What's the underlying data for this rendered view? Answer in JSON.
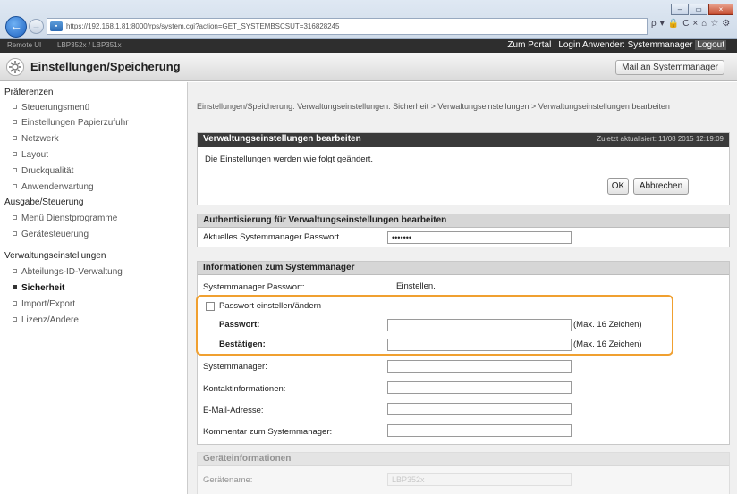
{
  "browser": {
    "url": "https://192.168.1.81:8000/rps/system.cgi?action=GET_SYSTEMBSCSUT=316828245",
    "tools": [
      "ρ",
      "▾",
      "🔒",
      "C",
      "×",
      "⌂",
      "☆",
      "⚙"
    ],
    "window_buttons": [
      "–",
      "▭",
      "×"
    ]
  },
  "topbar": {
    "device": "Remote UI",
    "model": "LBP352x / LBP351x",
    "links": [
      "Zum Portal",
      "Login Anwender: Systemmanager",
      "Logout"
    ]
  },
  "header": {
    "title": "Einstellungen/Speicherung",
    "mail_button": "Mail an Systemmanager"
  },
  "sidebar": {
    "categories": [
      {
        "label": "Präferenzen",
        "items": [
          "Steuerungsmenü",
          "Einstellungen Papierzufuhr",
          "Netzwerk",
          "Layout",
          "Druckqualität",
          "Anwenderwartung"
        ]
      },
      {
        "label": "Ausgabe/Steuerung",
        "items": [
          "Menü Dienstprogramme",
          "Gerätesteuerung"
        ]
      },
      {
        "label": "Verwaltungseinstellungen",
        "items": [
          "Abteilungs-ID-Verwaltung",
          "Sicherheit",
          "Import/Export",
          "Lizenz/Andere"
        ]
      }
    ],
    "active_item": "Sicherheit"
  },
  "main": {
    "breadcrumb": "Einstellungen/Speicherung: Verwaltungseinstellungen: Sicherheit > Verwaltungseinstellungen > Verwaltungseinstellungen bearbeiten",
    "edit_panel": {
      "title": "Verwaltungseinstellungen bearbeiten",
      "last_updated": "Zuletzt aktualisiert: 11/08 2015 12:19:09",
      "message": "Die Einstellungen werden wie folgt geändert.",
      "ok": "OK",
      "cancel": "Abbrechen"
    },
    "auth_panel": {
      "title": "Authentisierung für Verwaltungseinstellungen bearbeiten",
      "current_pw_label": "Aktuelles Systemmanager Passwort",
      "current_pw_value": "•••••••"
    },
    "info_panel": {
      "title": "Informationen zum Systemmanager",
      "pw_label": "Systemmanager Passwort:",
      "pw_status": "Einstellen.",
      "change_pw_label": "Passwort einstellen/ändern",
      "password_label": "Passwort:",
      "confirm_label": "Bestätigen:",
      "max_hint": "(Max. 16 Zeichen)",
      "manager_label": "Systemmanager:",
      "contact_label": "Kontaktinformationen:",
      "email_label": "E-Mail-Adresse:",
      "comment_label": "Kommentar zum Systemmanager:"
    },
    "device_panel": {
      "title": "Geräteinformationen",
      "device_name_label": "Gerätename:",
      "device_name_value": "LBP352x"
    }
  }
}
